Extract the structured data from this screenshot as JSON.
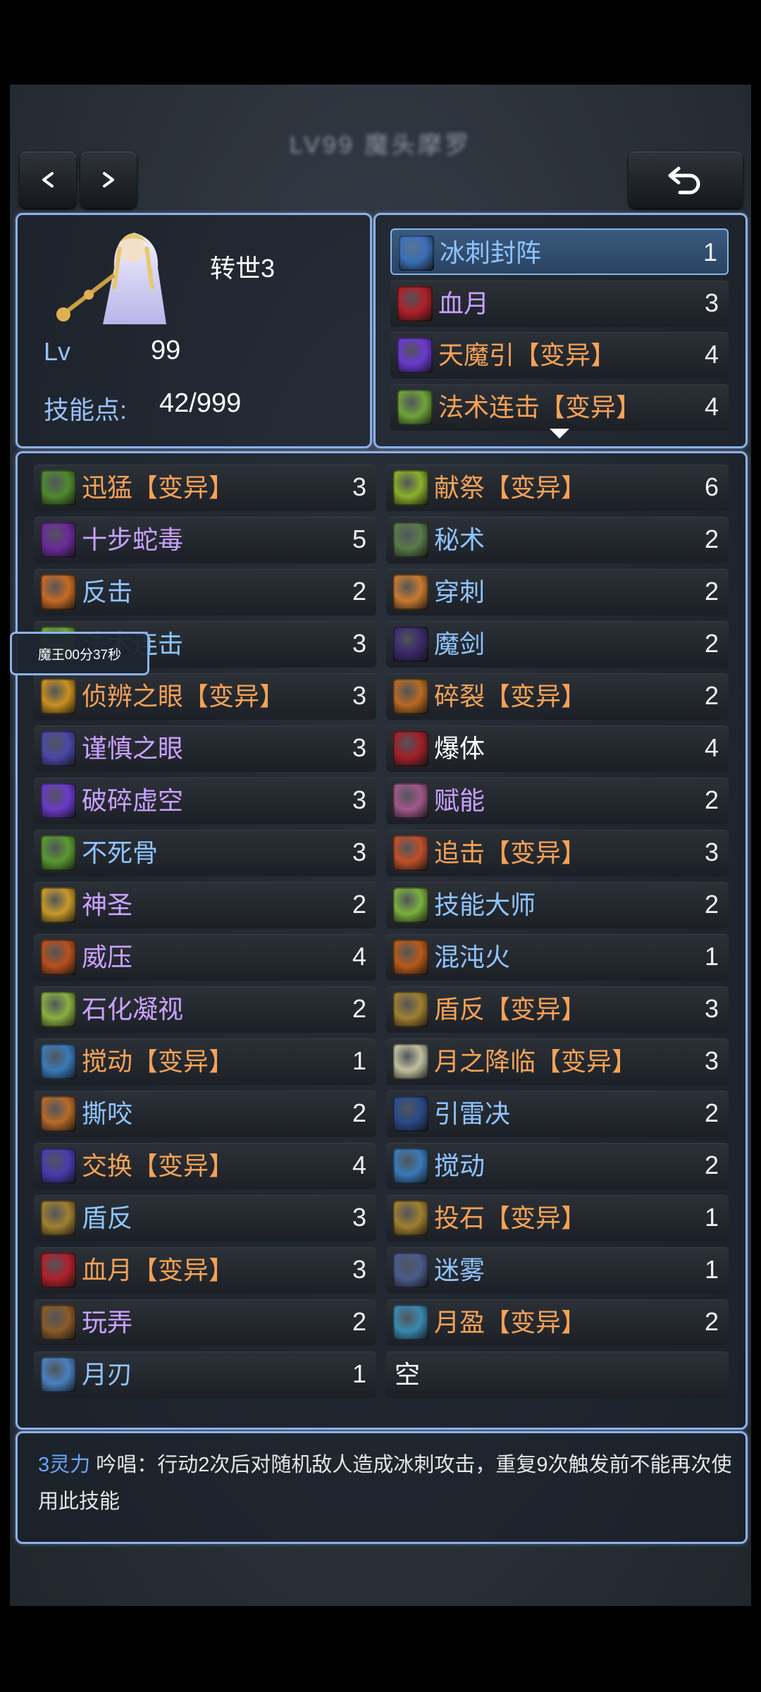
{
  "header": {
    "title": "LV99 魔头摩罗"
  },
  "icons": {
    "prev": "chevron-left-icon",
    "next": "chevron-right-icon",
    "back": "return-arrow-icon"
  },
  "character": {
    "rebirth": "转世3",
    "lv_label": "Lv",
    "lv_value": "99",
    "sp_label": "技能点:",
    "sp_value": "42/999"
  },
  "equipped": [
    {
      "name": "冰刺封阵",
      "level": "1",
      "color": "blue",
      "selected": true,
      "icon_color": "#3a6fb8"
    },
    {
      "name": "血月",
      "level": "3",
      "color": "purple",
      "icon_color": "#b0202a"
    },
    {
      "name": "天魔引【变异】",
      "level": "4",
      "color": "orange",
      "icon_color": "#6b3ad0"
    },
    {
      "name": "法术连击【变异】",
      "level": "4",
      "color": "orange",
      "icon_color": "#6fa43a"
    }
  ],
  "skills_left": [
    {
      "name": "迅猛【变异】",
      "level": "3",
      "color": "orange",
      "icon_color": "#4f8a2e"
    },
    {
      "name": "十步蛇毒",
      "level": "5",
      "color": "purple",
      "icon_color": "#6a2a9a"
    },
    {
      "name": "反击",
      "level": "2",
      "color": "blue",
      "icon_color": "#c86a24"
    },
    {
      "name": "法术连击",
      "level": "3",
      "color": "blue",
      "icon_color": "#6fa43a"
    },
    {
      "name": "侦辨之眼【变异】",
      "level": "3",
      "color": "orange",
      "icon_color": "#c89020"
    },
    {
      "name": "谨慎之眼",
      "level": "3",
      "color": "purple",
      "icon_color": "#4a48a8"
    },
    {
      "name": "破碎虚空",
      "level": "3",
      "color": "purple",
      "icon_color": "#6a3ac8"
    },
    {
      "name": "不死骨",
      "level": "3",
      "color": "blue",
      "icon_color": "#5a9a30"
    },
    {
      "name": "神圣",
      "level": "2",
      "color": "purple",
      "icon_color": "#c89a2a"
    },
    {
      "name": "威压",
      "level": "4",
      "color": "purple",
      "icon_color": "#b8501e"
    },
    {
      "name": "石化凝视",
      "level": "2",
      "color": "purple",
      "icon_color": "#8ab040"
    },
    {
      "name": "搅动【变异】",
      "level": "1",
      "color": "orange",
      "icon_color": "#3a7ab8"
    },
    {
      "name": "撕咬",
      "level": "2",
      "color": "blue",
      "icon_color": "#b86a2a"
    },
    {
      "name": "交换【变异】",
      "level": "4",
      "color": "orange",
      "icon_color": "#4a3ab0"
    },
    {
      "name": "盾反",
      "level": "3",
      "color": "blue",
      "icon_color": "#a08030"
    },
    {
      "name": "血月【变异】",
      "level": "3",
      "color": "orange",
      "icon_color": "#b0202a"
    },
    {
      "name": "玩弄",
      "level": "2",
      "color": "purple",
      "icon_color": "#8a5a2a"
    },
    {
      "name": "月刃",
      "level": "1",
      "color": "blue",
      "icon_color": "#4a80c0"
    }
  ],
  "skills_right": [
    {
      "name": "献祭【变异】",
      "level": "6",
      "color": "orange",
      "icon_color": "#8ab02a"
    },
    {
      "name": "秘术",
      "level": "2",
      "color": "blue",
      "icon_color": "#5a7a4a"
    },
    {
      "name": "穿刺",
      "level": "2",
      "color": "blue",
      "icon_color": "#c87a30"
    },
    {
      "name": "魔剑",
      "level": "2",
      "color": "blue",
      "icon_color": "#3a2a6a"
    },
    {
      "name": "碎裂【变异】",
      "level": "2",
      "color": "orange",
      "icon_color": "#b86a24"
    },
    {
      "name": "爆体",
      "level": "4",
      "color": "white",
      "icon_color": "#a0202a"
    },
    {
      "name": "赋能",
      "level": "2",
      "color": "purple",
      "icon_color": "#a0588a"
    },
    {
      "name": "追击【变异】",
      "level": "3",
      "color": "orange",
      "icon_color": "#c0502a"
    },
    {
      "name": "技能大师",
      "level": "2",
      "color": "blue",
      "icon_color": "#7ab040"
    },
    {
      "name": "混沌火",
      "level": "1",
      "color": "blue",
      "icon_color": "#b85a1a"
    },
    {
      "name": "盾反【变异】",
      "level": "3",
      "color": "orange",
      "icon_color": "#a08030"
    },
    {
      "name": "月之降临【变异】",
      "level": "3",
      "color": "orange",
      "icon_color": "#c0c0a0"
    },
    {
      "name": "引雷决",
      "level": "2",
      "color": "blue",
      "icon_color": "#2a4a8a"
    },
    {
      "name": "搅动",
      "level": "2",
      "color": "blue",
      "icon_color": "#3a7ab8"
    },
    {
      "name": "投石【变异】",
      "level": "1",
      "color": "orange",
      "icon_color": "#a08030"
    },
    {
      "name": "迷雾",
      "level": "1",
      "color": "blue",
      "icon_color": "#4a5a8a"
    },
    {
      "name": "月盈【变异】",
      "level": "2",
      "color": "orange",
      "icon_color": "#3a8ab0"
    },
    {
      "name": "空",
      "level": "",
      "color": "white",
      "empty": true
    }
  ],
  "tooltip": {
    "text": "魔王00分37秒"
  },
  "description": {
    "cost": "3灵力",
    "text": " 吟唱：行动2次后对随机敌人造成冰刺攻击，重复9次触发前不能再次使用此技能"
  }
}
